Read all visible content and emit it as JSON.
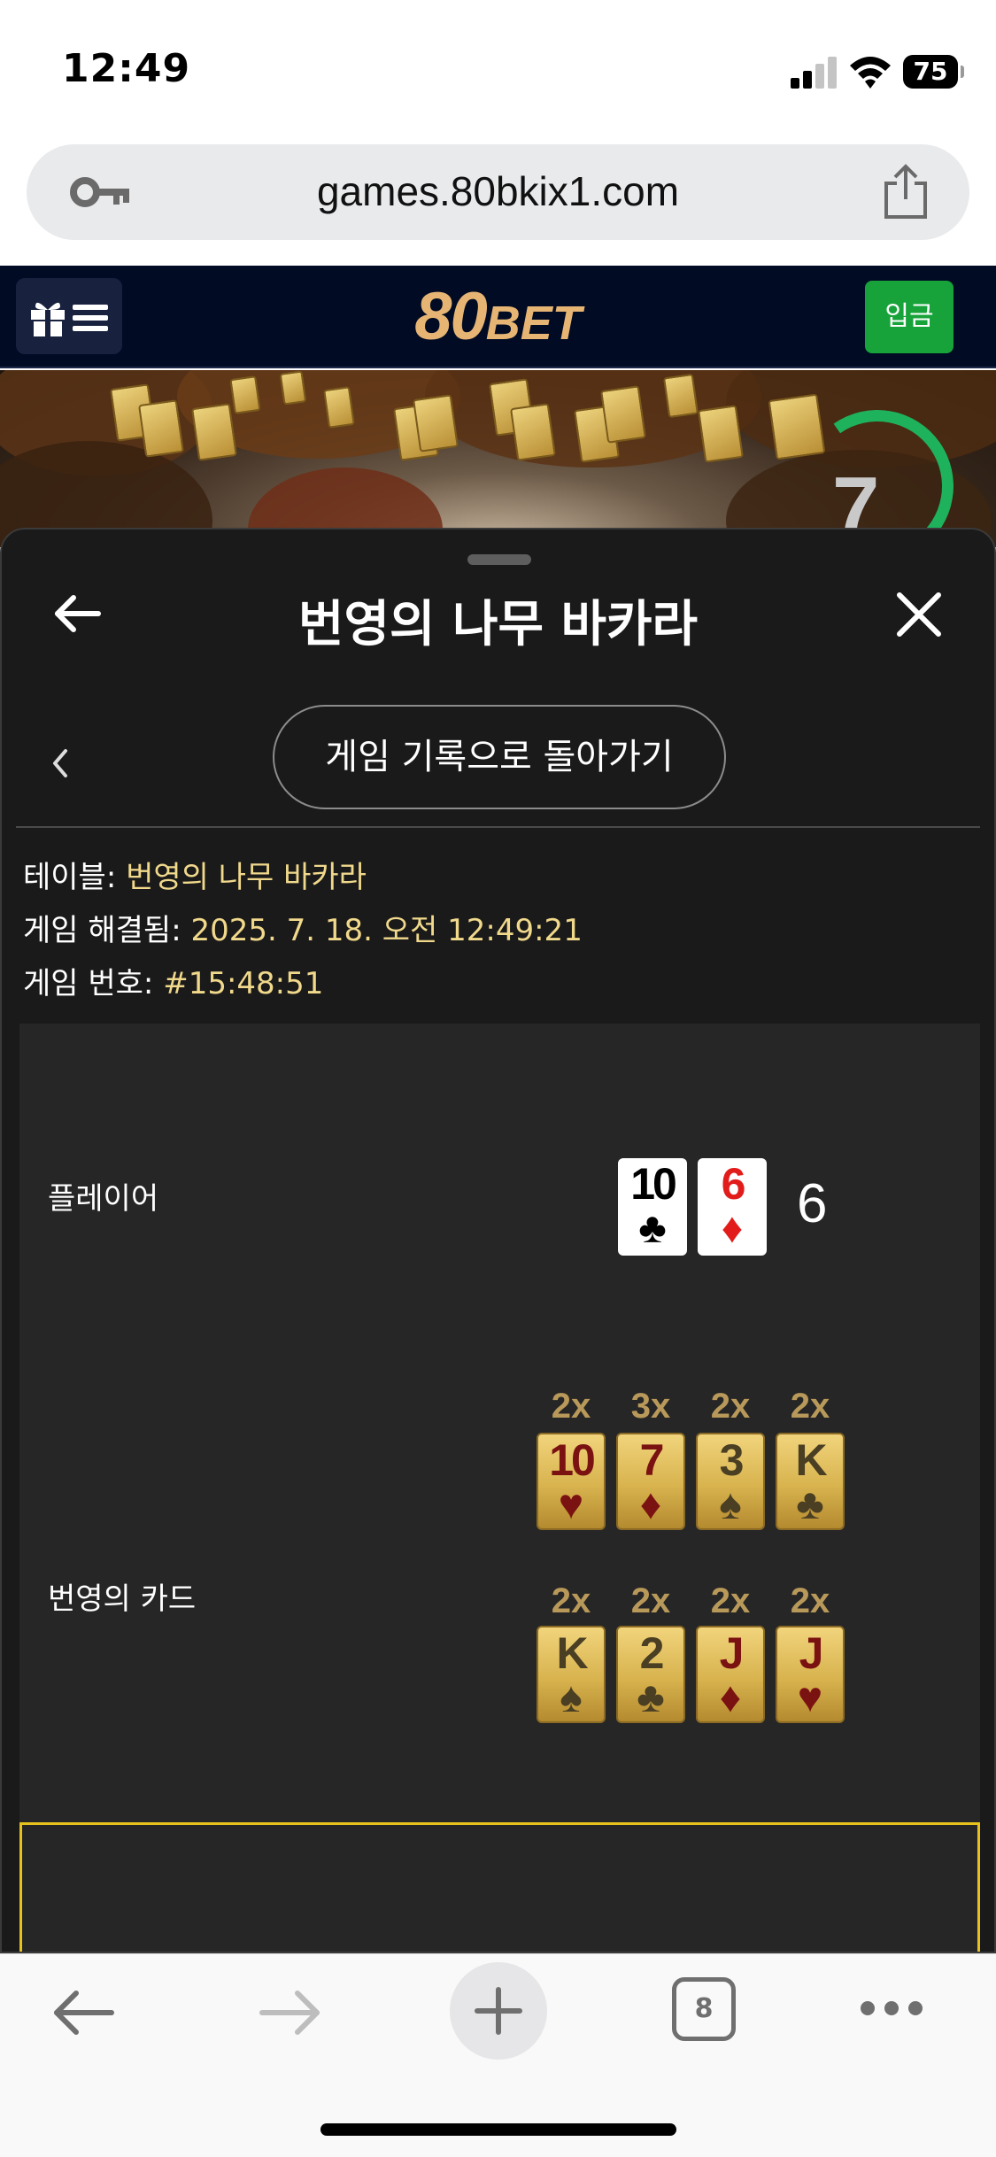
{
  "status_bar": {
    "time": "12:49",
    "battery": "75"
  },
  "browser": {
    "url": "games.80bkix1.com",
    "tab_count": "8"
  },
  "site_header": {
    "logo_number": "80",
    "logo_word": "BET",
    "deposit_label": "입금"
  },
  "game_view": {
    "timer": "7"
  },
  "sheet": {
    "title": "번영의 나무 바카라",
    "history_button": "게임 기록으로 돌아가기",
    "info": {
      "table_label": "테이블:",
      "table_value": "번영의 나무 바카라",
      "resolved_label": "게임 해결됨:",
      "resolved_value": "2025. 7. 18. 오전 12:49:21",
      "game_no_label": "게임 번호:",
      "game_no_value": "#15:48:51"
    },
    "player": {
      "label": "플레이어",
      "score": "6",
      "cards": [
        {
          "rank": "10",
          "suit": "♣",
          "color": "black"
        },
        {
          "rank": "6",
          "suit": "♦",
          "color": "red"
        }
      ]
    },
    "prosperity": {
      "label": "번영의 카드",
      "row1": [
        {
          "mult": "2x",
          "rank": "10",
          "suit": "♥",
          "color": "red"
        },
        {
          "mult": "3x",
          "rank": "7",
          "suit": "♦",
          "color": "red"
        },
        {
          "mult": "2x",
          "rank": "3",
          "suit": "♠",
          "color": "black"
        },
        {
          "mult": "2x",
          "rank": "K",
          "suit": "♣",
          "color": "black"
        }
      ],
      "row2": [
        {
          "mult": "2x",
          "rank": "K",
          "suit": "♠",
          "color": "black"
        },
        {
          "mult": "2x",
          "rank": "2",
          "suit": "♣",
          "color": "black"
        },
        {
          "mult": "2x",
          "rank": "J",
          "suit": "♦",
          "color": "red"
        },
        {
          "mult": "2x",
          "rank": "J",
          "suit": "♥",
          "color": "red"
        }
      ]
    }
  },
  "colors": {
    "accent_gold": "#f1d98c",
    "deposit_green": "#17a33a",
    "header_navy": "#020b24",
    "frame_yellow": "#e7c21c"
  },
  "icons": [
    "signal-icon",
    "wifi-icon",
    "battery-icon",
    "key-icon",
    "share-icon",
    "gift-icon",
    "menu-icon",
    "back-arrow-icon",
    "close-icon",
    "chevron-left-icon",
    "plus-icon",
    "forward-arrow-icon",
    "tabs-icon",
    "more-icon"
  ]
}
